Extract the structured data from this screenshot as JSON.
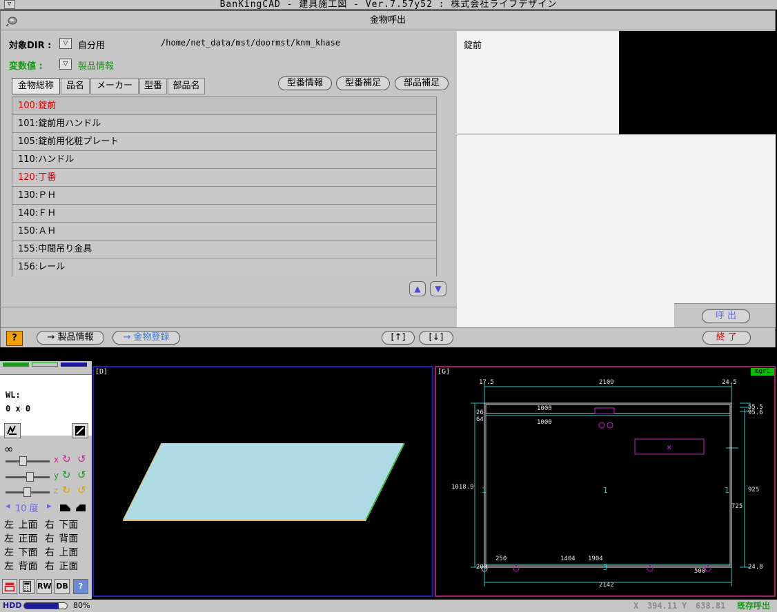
{
  "window": {
    "title": "BanKingCAD - 建具施工図 - Ver.7.57y52 : 株式会社ライフデザイン",
    "menu_arrow": "▽"
  },
  "dialog": {
    "title": "金物呼出",
    "target_dir_label": "対象DIR :",
    "target_dir_value": "自分用",
    "path": "/home/net_data/mst/doormst/knm_khase",
    "variable_label": "変数値 :",
    "variable_value": "製品情報",
    "dropdown_glyph": "▽",
    "tabs": [
      {
        "label": "金物総称",
        "active": true
      },
      {
        "label": "品名",
        "active": false
      },
      {
        "label": "メーカー",
        "active": false
      },
      {
        "label": "型番",
        "active": false
      },
      {
        "label": "部品名",
        "active": false
      }
    ],
    "right_buttons": [
      "型番情報",
      "型番補足",
      "部品補足"
    ],
    "items": [
      {
        "text": "100:錠前",
        "color": "#e00000"
      },
      {
        "text": "101:錠前用ハンドル",
        "color": "#000000"
      },
      {
        "text": "105:錠前用化粧プレート",
        "color": "#000000"
      },
      {
        "text": "110:ハンドル",
        "color": "#000000"
      },
      {
        "text": "120:丁番",
        "color": "#e00000"
      },
      {
        "text": "130:ＰＨ",
        "color": "#000000"
      },
      {
        "text": "140:ＦＨ",
        "color": "#000000"
      },
      {
        "text": "150:ＡＨ",
        "color": "#000000"
      },
      {
        "text": "155:中間吊り金具",
        "color": "#000000"
      },
      {
        "text": "156:レール",
        "color": "#000000"
      }
    ],
    "scroll_up": "▲",
    "scroll_down": "▼",
    "preview_title": "錠前",
    "call_button": "呼 出",
    "help_label": "?",
    "product_info_button": "→ 製品情報",
    "register_button": "→ 金物登録",
    "up_button": "[↑]",
    "down_button": "[↓]",
    "exit_button": "終 了"
  },
  "left_panel": {
    "wl_label": "WL:",
    "wl_value": "0 x 0",
    "infinity": "∞",
    "axis_x": "x",
    "axis_y": "y",
    "axis_z": "z",
    "angle_left": "◂",
    "angle_value": "10 度",
    "angle_right": "▸",
    "view_rows": [
      [
        "左",
        "上面",
        "右",
        "下面"
      ],
      [
        "左",
        "正面",
        "右",
        "背面"
      ],
      [
        "左",
        "下面",
        "右",
        "上面"
      ],
      [
        "左",
        "背面",
        "右",
        "正面"
      ]
    ],
    "tool_rw": "RW",
    "tool_db": "DB",
    "tool_help": "?"
  },
  "view_d": {
    "label": "[D]"
  },
  "view_g": {
    "label": "[G]",
    "badge": "mgrC",
    "dims": {
      "top_left": "17.5",
      "top_mid": "2109",
      "top_right": "24.5",
      "d1000a": "1000",
      "d1000b": "1000",
      "d26": "26",
      "d64": "64",
      "left_h": "1018.9",
      "right_925": "925",
      "right_725": "725",
      "right_555": "55.5",
      "right_956": "95.6",
      "bot_250": "250",
      "bot_1404": "1404",
      "bot_1904": "1904",
      "bot_500": "500",
      "bot_200": "200",
      "bot_248": "24.8",
      "bot_total": "2142",
      "mark_1a": "1",
      "mark_1b": "1",
      "mark_1c": "1",
      "mark_3": "3"
    }
  },
  "status": {
    "hdd_label": "HDD",
    "hdd_percent": "80%",
    "hdd_fill": 0.8,
    "x_label": "X",
    "x_value": "394.11",
    "y_label": "Y",
    "y_value": "638.81",
    "mode": "既存呼出"
  }
}
